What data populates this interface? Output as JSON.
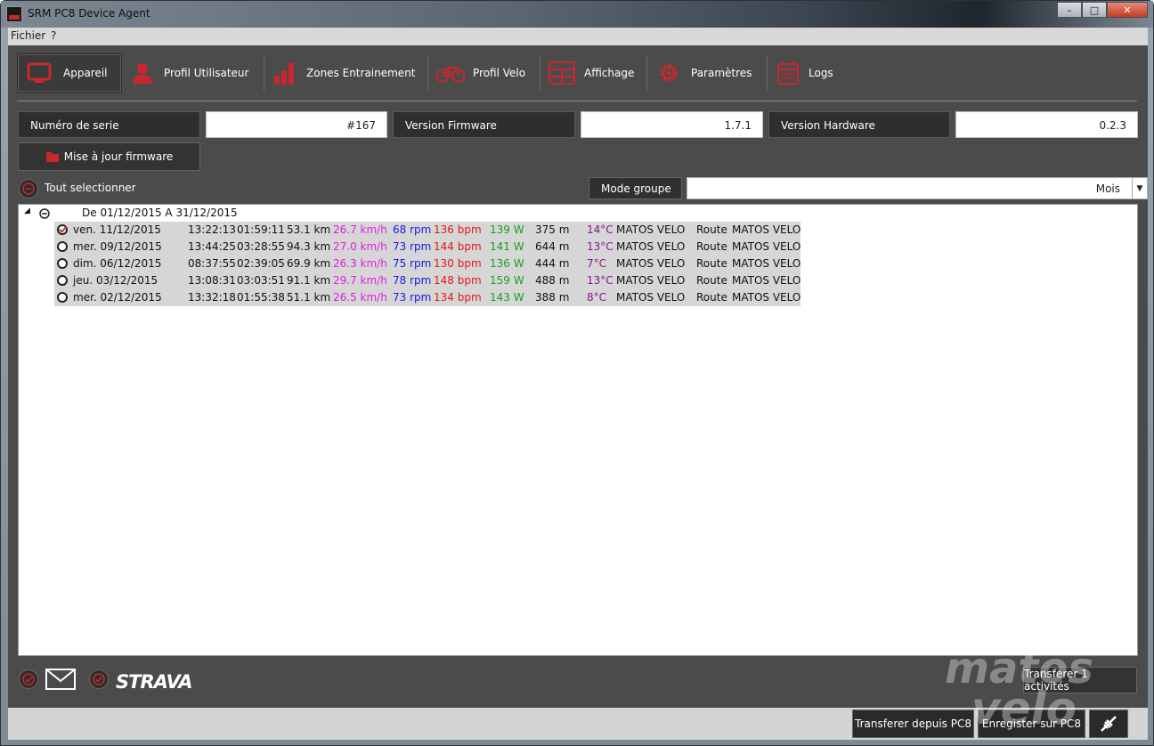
{
  "window": {
    "title": "SRM PC8 Device Agent",
    "buttons": [
      "–",
      "□",
      "✕"
    ]
  },
  "menu": [
    "Fichier",
    "?"
  ],
  "tabs": [
    {
      "label": "Appareil",
      "icon": "monitor-icon",
      "active": true
    },
    {
      "label": "Profil Utilisateur",
      "icon": "user-icon"
    },
    {
      "label": "Zones Entrainement",
      "icon": "bar-chart-icon"
    },
    {
      "label": "Profil Velo",
      "icon": "bicycle-icon"
    },
    {
      "label": "Affichage",
      "icon": "display-icon"
    },
    {
      "label": "Paramètres",
      "icon": "gear-icon"
    },
    {
      "label": "Logs",
      "icon": "calendar-icon"
    }
  ],
  "device": {
    "serial_label": "Numéro de serie",
    "serial_value": "#167",
    "firmware_label": "Version Firmware",
    "firmware_value": "1.7.1",
    "hardware_label": "Version Hardware",
    "hardware_value": "0.2.3",
    "update_button": "Mise à jour firmware"
  },
  "selection": {
    "select_all": "Tout selectionner",
    "mode_label": "Mode groupe",
    "mode_value": "Mois"
  },
  "group": {
    "title": "De 01/12/2015  A 31/12/2015"
  },
  "rows": [
    {
      "checked": true,
      "date": "ven. 11/12/2015",
      "start": "13:22:13",
      "duration": "01:59:11",
      "distance": "53.1 km",
      "speed": "26.7 km/h",
      "cadence": "68 rpm",
      "hr": "136 bpm",
      "power": "139 W",
      "elev": "375 m",
      "temp": "14°C",
      "bike": "MATOS VELO",
      "type": "Route",
      "name": "MATOS VELO"
    },
    {
      "checked": false,
      "date": "mer. 09/12/2015",
      "start": "13:44:25",
      "duration": "03:28:55",
      "distance": "94.3 km",
      "speed": "27.0 km/h",
      "cadence": "73 rpm",
      "hr": "144 bpm",
      "power": "141 W",
      "elev": "644 m",
      "temp": "13°C",
      "bike": "MATOS VELO",
      "type": "Route",
      "name": "MATOS VELO"
    },
    {
      "checked": false,
      "date": "dim. 06/12/2015",
      "start": "08:37:55",
      "duration": "02:39:05",
      "distance": "69.9 km",
      "speed": "26.3 km/h",
      "cadence": "75 rpm",
      "hr": "130 bpm",
      "power": "136 W",
      "elev": "444 m",
      "temp": "7°C",
      "bike": "MATOS VELO",
      "type": "Route",
      "name": "MATOS VELO"
    },
    {
      "checked": false,
      "date": "jeu. 03/12/2015",
      "start": "13:08:31",
      "duration": "03:03:51",
      "distance": "91.1 km",
      "speed": "29.7 km/h",
      "cadence": "78 rpm",
      "hr": "148 bpm",
      "power": "159 W",
      "elev": "488 m",
      "temp": "13°C",
      "bike": "MATOS VELO",
      "type": "Route",
      "name": "MATOS VELO"
    },
    {
      "checked": false,
      "date": "mer. 02/12/2015",
      "start": "13:32:18",
      "duration": "01:55:38",
      "distance": "51.1 km",
      "speed": "26.5 km/h",
      "cadence": "73 rpm",
      "hr": "134 bpm",
      "power": "143 W",
      "elev": "388 m",
      "temp": "8°C",
      "bike": "MATOS VELO",
      "type": "Route",
      "name": "MATOS VELO"
    }
  ],
  "colors": {
    "accent": "#c8282d",
    "speed": "#e020e0",
    "cadence": "#1a1ae0",
    "hr": "#e01a1a",
    "power": "#1aa01a",
    "temp": "#901090"
  },
  "footer": {
    "strava": "STRAVA",
    "transfer_button": "Transferer 1 activités"
  },
  "statusbar": {
    "from_pc8": "Transferer depuis PC8",
    "save_pc8": "Enregister sur PC8"
  },
  "watermark": [
    "matos",
    "velo"
  ]
}
